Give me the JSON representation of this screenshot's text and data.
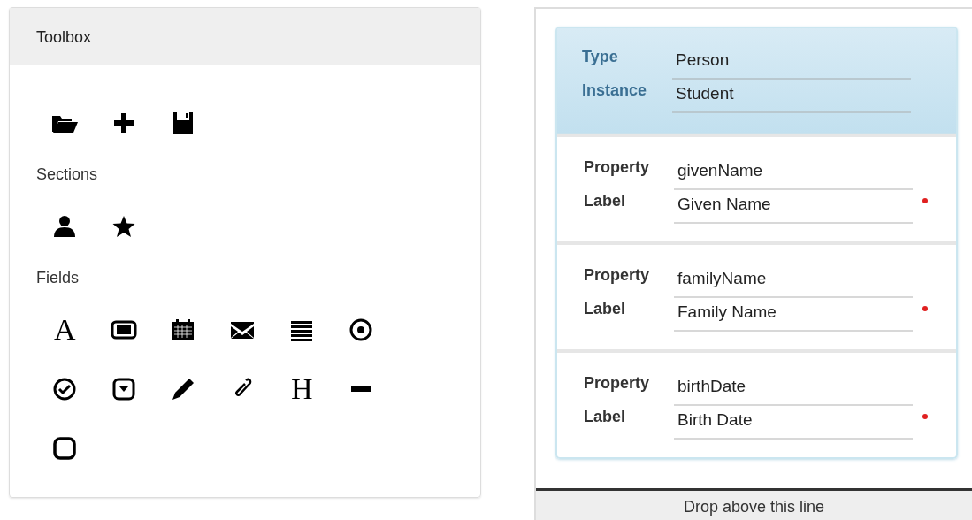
{
  "toolbox": {
    "title": "Toolbox",
    "sections_label": "Sections",
    "fields_label": "Fields",
    "field_tools": [
      {
        "kind": "glyph",
        "text": "A"
      },
      {
        "kind": "icon"
      },
      {
        "kind": "icon"
      },
      {
        "kind": "icon"
      },
      {
        "kind": "icon"
      },
      {
        "kind": "icon"
      },
      {
        "kind": "icon"
      },
      {
        "kind": "icon"
      },
      {
        "kind": "icon"
      },
      {
        "kind": "icon"
      },
      {
        "kind": "glyph",
        "text": "H"
      },
      {
        "kind": "icon"
      },
      {
        "kind": "icon"
      }
    ]
  },
  "form": {
    "header": [
      {
        "label": "Type",
        "value": "Person"
      },
      {
        "label": "Instance",
        "value": "Student"
      }
    ],
    "sections": [
      {
        "property_label": "Property",
        "property": "givenName",
        "label_label": "Label",
        "label": "Given Name",
        "required": true
      },
      {
        "property_label": "Property",
        "property": "familyName",
        "label_label": "Label",
        "label": "Family Name",
        "required": true
      },
      {
        "property_label": "Property",
        "property": "birthDate",
        "label_label": "Label",
        "label": "Birth Date",
        "required": true
      }
    ],
    "drop_hint": "Drop above this line"
  }
}
